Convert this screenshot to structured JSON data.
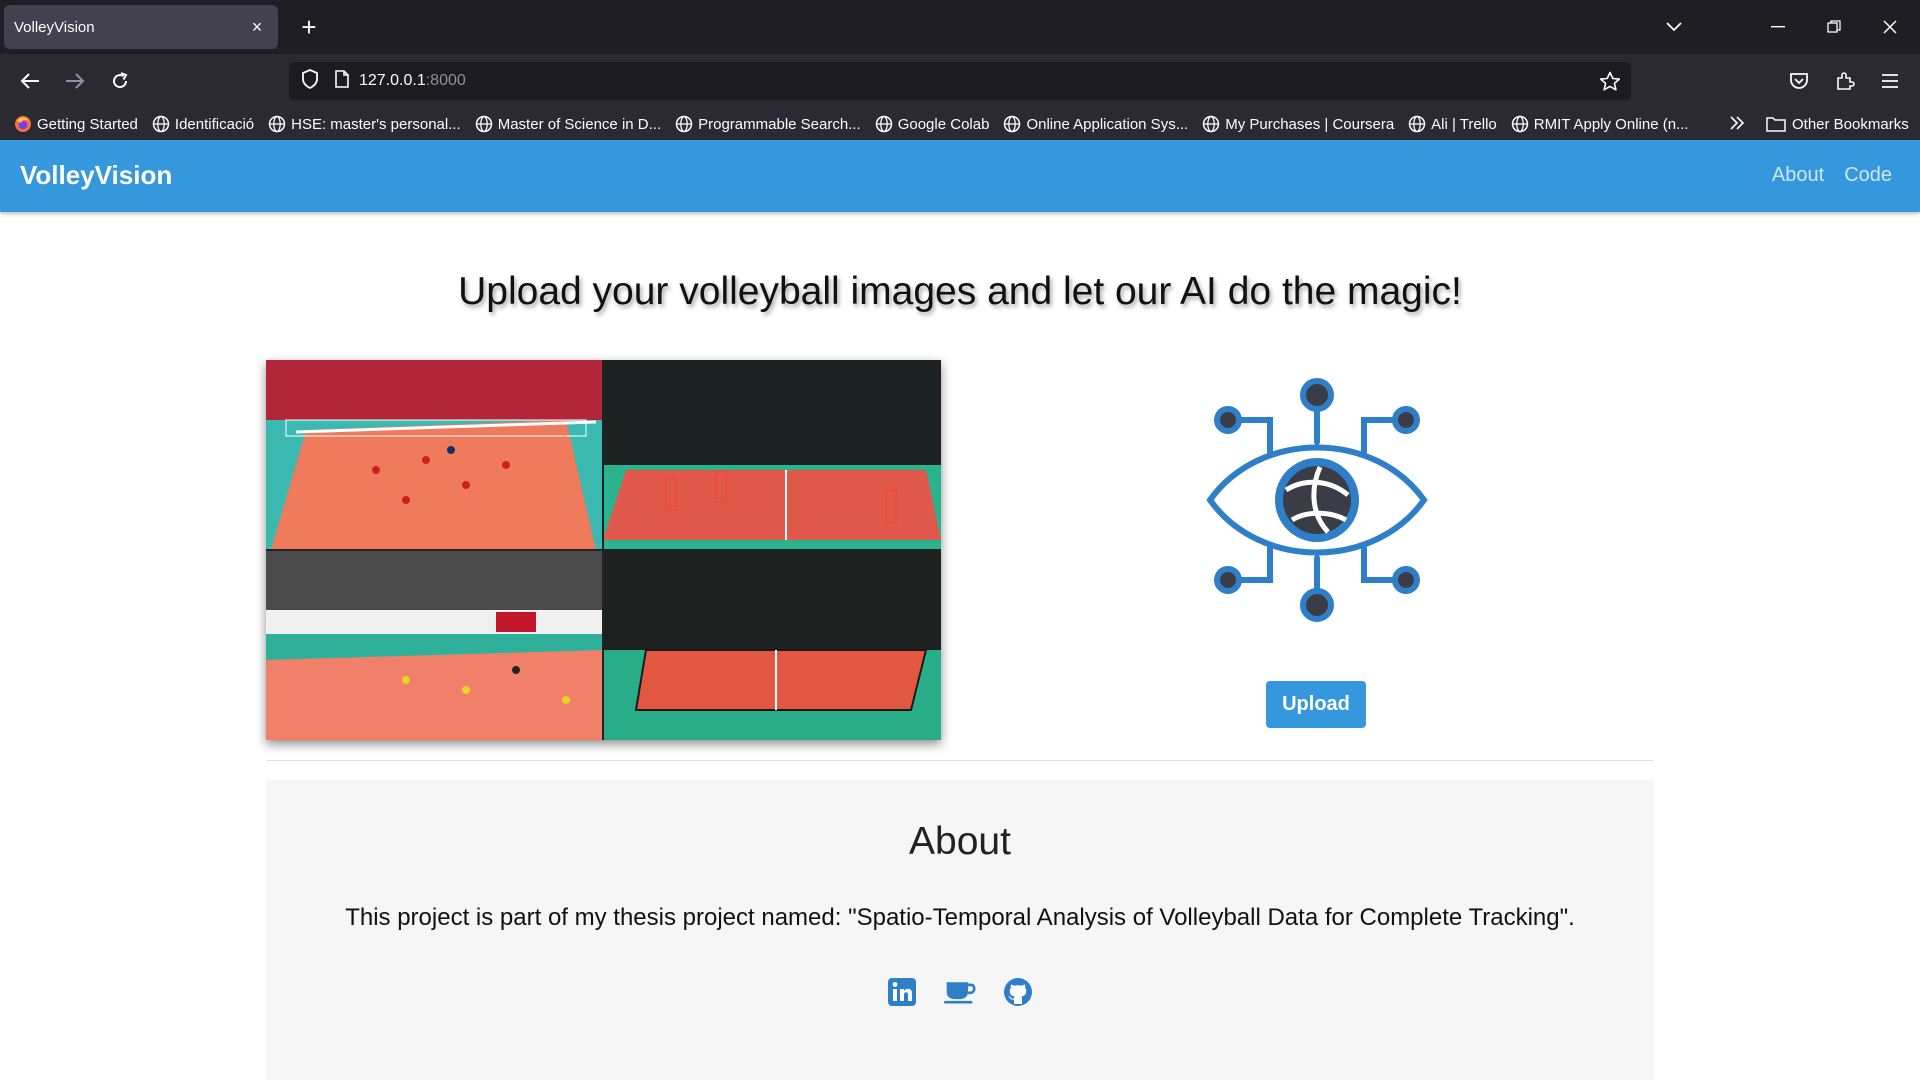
{
  "browser": {
    "tab_title": "VolleyVision",
    "url_host": "127.0.0.1",
    "url_port": ":8000",
    "bookmarks": [
      "Getting Started",
      "Identificació",
      "HSE: master's personal...",
      "Master of Science in D...",
      "Programmable Search...",
      "Google Colab",
      "Online Application Sys...",
      "My Purchases | Coursera",
      "Ali | Trello",
      "RMIT Apply Online (n..."
    ],
    "other_bookmarks": "Other Bookmarks"
  },
  "site": {
    "brand": "VolleyVision",
    "nav": {
      "about": "About",
      "code": "Code"
    },
    "headline": "Upload your volleyball images and let our AI do the magic!",
    "upload_label": "Upload",
    "accent_color": "#3598dc"
  },
  "about": {
    "title": "About",
    "text": "This project is part of my thesis project named: \"Spatio-Temporal Analysis of Volleyball Data for Complete Tracking\".",
    "social_icons": [
      "linkedin-icon",
      "coffee-icon",
      "github-icon"
    ]
  },
  "icons": {
    "tab_close": "×",
    "new_tab": "+"
  }
}
